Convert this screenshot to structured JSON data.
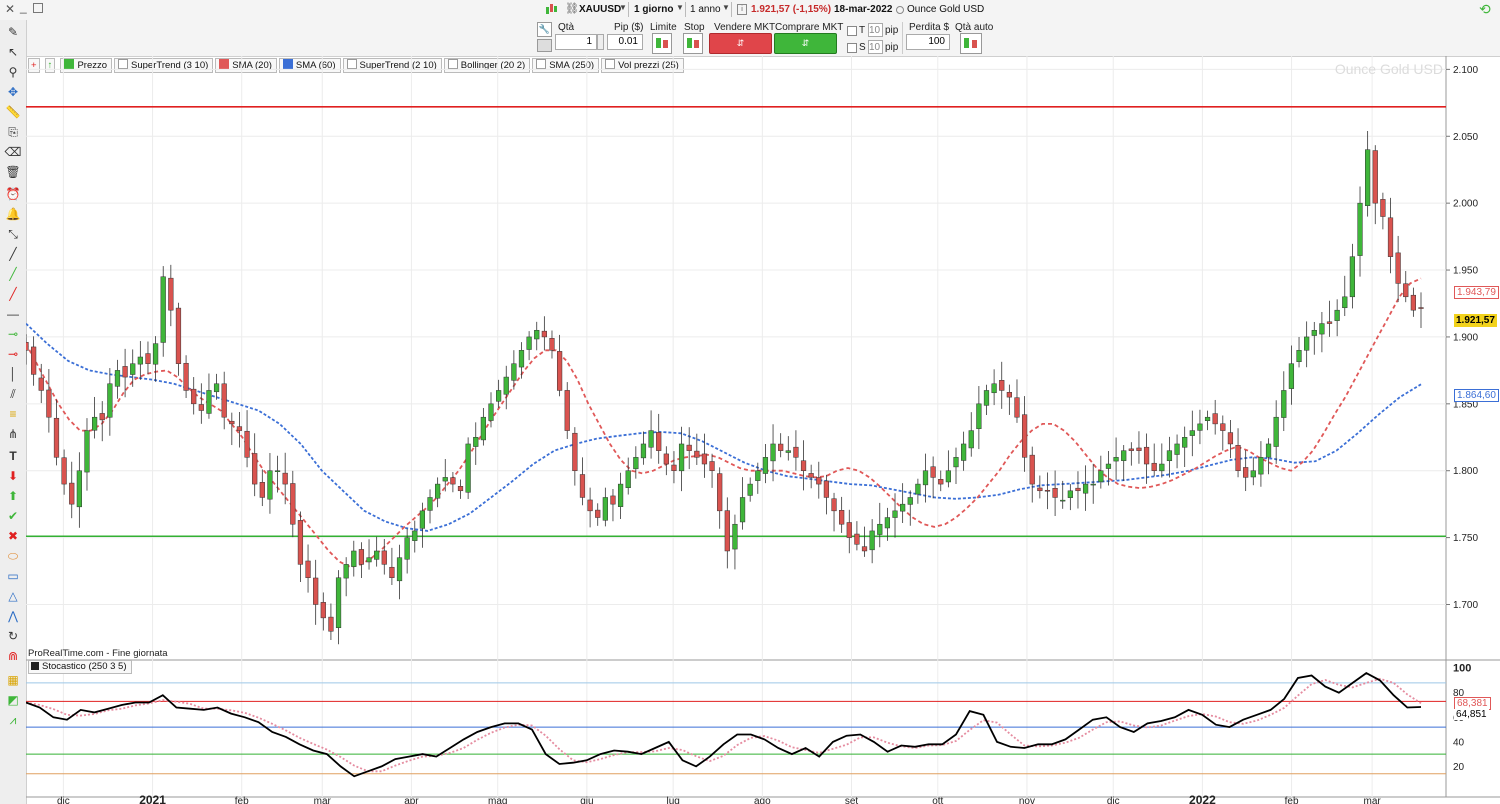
{
  "window": {
    "symbol": "XAUUSD",
    "interval": "1 giorno",
    "range": "1 anno",
    "last_price": "1.921,57 (-1,15%)",
    "date": "18-mar-2022",
    "instrument_name": "Ounce Gold USD"
  },
  "order_bar": {
    "qty_label": "Qtà",
    "qty_value": "1",
    "pip_label": "Pip ($)",
    "pip_value": "0.01",
    "limit_label": "Limite",
    "stop_label": "Stop",
    "sell_label": "Vendere MKT",
    "buy_label": "Comprare MKT",
    "t_label": "T",
    "s_label": "S",
    "t_pips": "10",
    "s_pips": "10",
    "pip_unit": "pip",
    "loss_label": "Perdita $",
    "loss_value": "100",
    "auto_qty_label": "Qtà auto"
  },
  "legend": {
    "items": [
      "Prezzo",
      "SuperTrend (3 10)",
      "SMA (20)",
      "SMA (60)",
      "SuperTrend (2 10)",
      "Bollinger (20 2)",
      "SMA (250)",
      "Vol prezzi (25)"
    ],
    "colors": [
      "#3fb63a",
      "#ffffff",
      "#e05858",
      "#3b6fd6",
      "#ffffff",
      "#ffffff",
      "#ffffff",
      "#ffffff"
    ]
  },
  "footer_text": "ProRealTime.com - Fine giornata",
  "stoch_legend": "Stocastico (250 3 5)",
  "price_labels": {
    "sma20": "1.943,79",
    "last": "1.921,57",
    "sma60": "1.864,60"
  },
  "stoch_labels": {
    "k": "68,381",
    "d": "64,851"
  },
  "colors": {
    "up": "#3fb63a",
    "down": "#d9534f",
    "resistance": "#e02020",
    "support": "#33b033",
    "sma20": "#e05858",
    "sma60": "#3b6fd6",
    "stoch": "#000000"
  },
  "chart_data": [
    {
      "type": "candlestick",
      "title": "Ounce Gold USD",
      "ylim": [
        1660,
        2110
      ],
      "yticks": [
        "1.700",
        "1.750",
        "1.800",
        "1.850",
        "1.900",
        "1.950",
        "2.000",
        "2.050",
        "2.100"
      ],
      "ytick_values": [
        1700,
        1750,
        1800,
        1850,
        1900,
        1950,
        2000,
        2050,
        2100
      ],
      "xticks": [
        "dic",
        "2021",
        "feb",
        "mar",
        "apr",
        "mag",
        "giu",
        "lug",
        "ago",
        "set",
        "ott",
        "nov",
        "dic",
        "2022",
        "feb",
        "mar"
      ],
      "xtick_dates": [
        "2020-12-01",
        "2021-01-01",
        "2021-02-01",
        "2021-03-01",
        "2021-04-01",
        "2021-05-01",
        "2021-06-01",
        "2021-07-01",
        "2021-08-01",
        "2021-09-01",
        "2021-10-01",
        "2021-11-01",
        "2021-12-01",
        "2022-01-01",
        "2022-02-01",
        "2022-03-01"
      ],
      "x_start": "2020-11-18",
      "x_end": "2022-03-18",
      "horizontal_lines": [
        {
          "value": 2072,
          "color": "#e02020"
        },
        {
          "value": 1751,
          "color": "#33b033"
        }
      ],
      "series": [
        {
          "name": "Prezzo",
          "closes": [
            1890,
            1872,
            1860,
            1840,
            1810,
            1790,
            1775,
            1800,
            1830,
            1840,
            1838,
            1865,
            1875,
            1870,
            1880,
            1885,
            1880,
            1895,
            1945,
            1920,
            1880,
            1860,
            1850,
            1845,
            1860,
            1865,
            1840,
            1835,
            1830,
            1810,
            1790,
            1780,
            1800,
            1800,
            1790,
            1760,
            1730,
            1720,
            1700,
            1690,
            1680,
            1720,
            1730,
            1740,
            1730,
            1735,
            1740,
            1730,
            1720,
            1735,
            1750,
            1755,
            1770,
            1780,
            1790,
            1795,
            1790,
            1785,
            1820,
            1825,
            1840,
            1850,
            1860,
            1870,
            1880,
            1890,
            1900,
            1905,
            1900,
            1890,
            1860,
            1830,
            1800,
            1780,
            1770,
            1765,
            1780,
            1775,
            1790,
            1800,
            1810,
            1820,
            1830,
            1815,
            1805,
            1800,
            1820,
            1815,
            1810,
            1805,
            1800,
            1770,
            1740,
            1760,
            1780,
            1790,
            1800,
            1810,
            1820,
            1815,
            1815,
            1810,
            1800,
            1795,
            1790,
            1780,
            1770,
            1760,
            1750,
            1745,
            1740,
            1755,
            1760,
            1765,
            1770,
            1775,
            1780,
            1790,
            1800,
            1795,
            1790,
            1800,
            1810,
            1820,
            1830,
            1850,
            1860,
            1865,
            1860,
            1855,
            1840,
            1810,
            1790,
            1785,
            1785,
            1780,
            1778,
            1785,
            1785,
            1790,
            1790,
            1800,
            1805,
            1810,
            1815,
            1815,
            1815,
            1805,
            1800,
            1805,
            1815,
            1820,
            1825,
            1830,
            1835,
            1840,
            1835,
            1830,
            1820,
            1800,
            1795,
            1800,
            1810,
            1820,
            1840,
            1860,
            1880,
            1890,
            1900,
            1905,
            1910,
            1910,
            1920,
            1930,
            1960,
            2000,
            2040,
            2000,
            1990,
            1960,
            1940,
            1930,
            1920,
            1921.57
          ]
        },
        {
          "name": "SMA (20)",
          "values": [
            1895,
            1880,
            1865,
            1850,
            1838,
            1830,
            1830,
            1835,
            1845,
            1858,
            1868,
            1872,
            1874,
            1875,
            1870,
            1862,
            1855,
            1850,
            1845,
            1835,
            1825,
            1812,
            1800,
            1790,
            1780,
            1770,
            1760,
            1750,
            1740,
            1732,
            1728,
            1730,
            1735,
            1742,
            1750,
            1758,
            1765,
            1772,
            1780,
            1790,
            1800,
            1812,
            1825,
            1838,
            1850,
            1862,
            1874,
            1884,
            1890,
            1890,
            1882,
            1868,
            1850,
            1835,
            1820,
            1808,
            1800,
            1798,
            1800,
            1804,
            1808,
            1810,
            1811,
            1812,
            1810,
            1806,
            1802,
            1800,
            1800,
            1800,
            1800,
            1798,
            1796,
            1795,
            1796,
            1800,
            1802,
            1800,
            1795,
            1788,
            1780,
            1772,
            1765,
            1760,
            1758,
            1760,
            1765,
            1772,
            1780,
            1790,
            1800,
            1812,
            1822,
            1830,
            1835,
            1835,
            1830,
            1822,
            1812,
            1802,
            1795,
            1790,
            1788,
            1787,
            1788,
            1790,
            1793,
            1797,
            1801,
            1806,
            1811,
            1815,
            1818,
            1815,
            1810,
            1806,
            1802,
            1800,
            1806,
            1815,
            1828,
            1842,
            1855,
            1870,
            1885,
            1900,
            1915,
            1930,
            1940,
            1943.79
          ]
        },
        {
          "name": "SMA (60)",
          "values": [
            1910,
            1895,
            1882,
            1875,
            1872,
            1870,
            1868,
            1865,
            1860,
            1855,
            1850,
            1845,
            1835,
            1820,
            1800,
            1785,
            1770,
            1762,
            1757,
            1755,
            1760,
            1768,
            1780,
            1792,
            1805,
            1815,
            1820,
            1824,
            1826,
            1828,
            1829,
            1828,
            1822,
            1814,
            1806,
            1800,
            1796,
            1794,
            1792,
            1790,
            1789,
            1786,
            1783,
            1780,
            1779,
            1780,
            1782,
            1786,
            1789,
            1790,
            1791,
            1792,
            1793,
            1795,
            1797,
            1800,
            1804,
            1808,
            1810,
            1809,
            1806,
            1807,
            1815,
            1828,
            1842,
            1855,
            1864.6
          ]
        },
        {
          "name": "Stocastico (250 3 5)",
          "ylim": [
            0,
            105
          ],
          "yticks": [
            "20",
            "40",
            "60",
            "80",
            "100"
          ],
          "ytick_values": [
            20,
            40,
            60,
            80,
            100
          ],
          "levels": [
            88,
            73,
            52,
            30,
            14
          ],
          "values": [
            72,
            68,
            60,
            58,
            66,
            64,
            67,
            70,
            72,
            72,
            78,
            68,
            67,
            66,
            68,
            63,
            60,
            56,
            48,
            44,
            38,
            33,
            30,
            20,
            12,
            16,
            20,
            26,
            28,
            30,
            28,
            35,
            42,
            48,
            52,
            55,
            55,
            50,
            30,
            22,
            23,
            25,
            30,
            33,
            32,
            30,
            35,
            40,
            25,
            20,
            28,
            38,
            46,
            46,
            42,
            35,
            30,
            35,
            28,
            40,
            45,
            46,
            40,
            32,
            37,
            36,
            38,
            38,
            46,
            65,
            62,
            40,
            36,
            35,
            38,
            38,
            42,
            50,
            58,
            60,
            52,
            48,
            55,
            57,
            60,
            66,
            62,
            54,
            52,
            58,
            62,
            66,
            75,
            92,
            94,
            85,
            80,
            88,
            96,
            90,
            78,
            68,
            68.381
          ]
        }
      ]
    }
  ]
}
